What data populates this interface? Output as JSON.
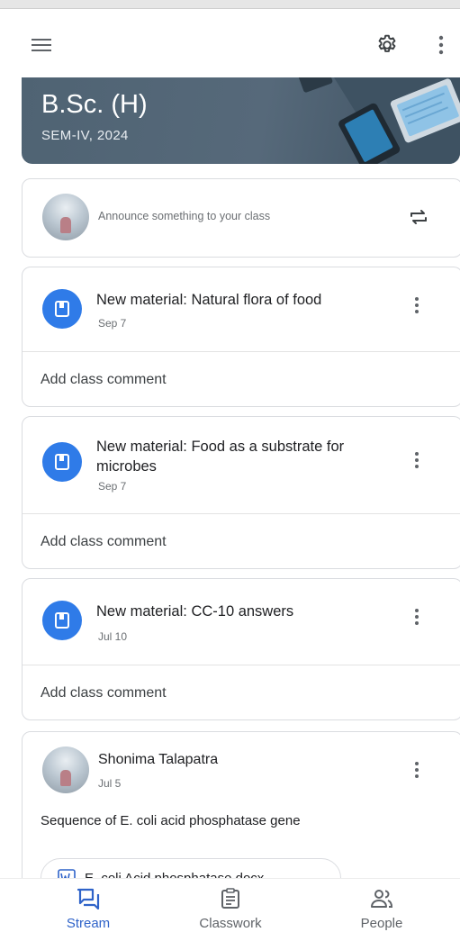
{
  "header": {
    "menu_icon": "hamburger-menu-icon",
    "settings_icon": "gear-icon",
    "more_icon": "more-vert-icon"
  },
  "banner": {
    "title": "B.Sc. (H)",
    "subtitle": "SEM-IV, 2024"
  },
  "announce": {
    "placeholder": "Announce something to your class",
    "repost_icon": "repost-icon"
  },
  "materials": [
    {
      "title": "New material: Natural flora of food",
      "date": "Sep 7",
      "comment": "Add class comment"
    },
    {
      "title": "New material: Food as a substrate for microbes",
      "date": "Sep 7",
      "comment": "Add class comment"
    },
    {
      "title": "New material: CC-10 answers",
      "date": "Jul 10",
      "comment": "Add class comment"
    }
  ],
  "post": {
    "author": "Shonima Talapatra",
    "date": "Jul 5",
    "body": "Sequence of E. coli acid phosphatase gene",
    "attachment": "E. coli Acid phosphatase.docx",
    "attachment_icon": "word-doc-icon"
  },
  "nav": {
    "stream": "Stream",
    "classwork": "Classwork",
    "people": "People"
  },
  "colors": {
    "accent": "#2f63c9",
    "material_icon_bg": "#2f7be8",
    "banner_bg": "#56697a"
  }
}
